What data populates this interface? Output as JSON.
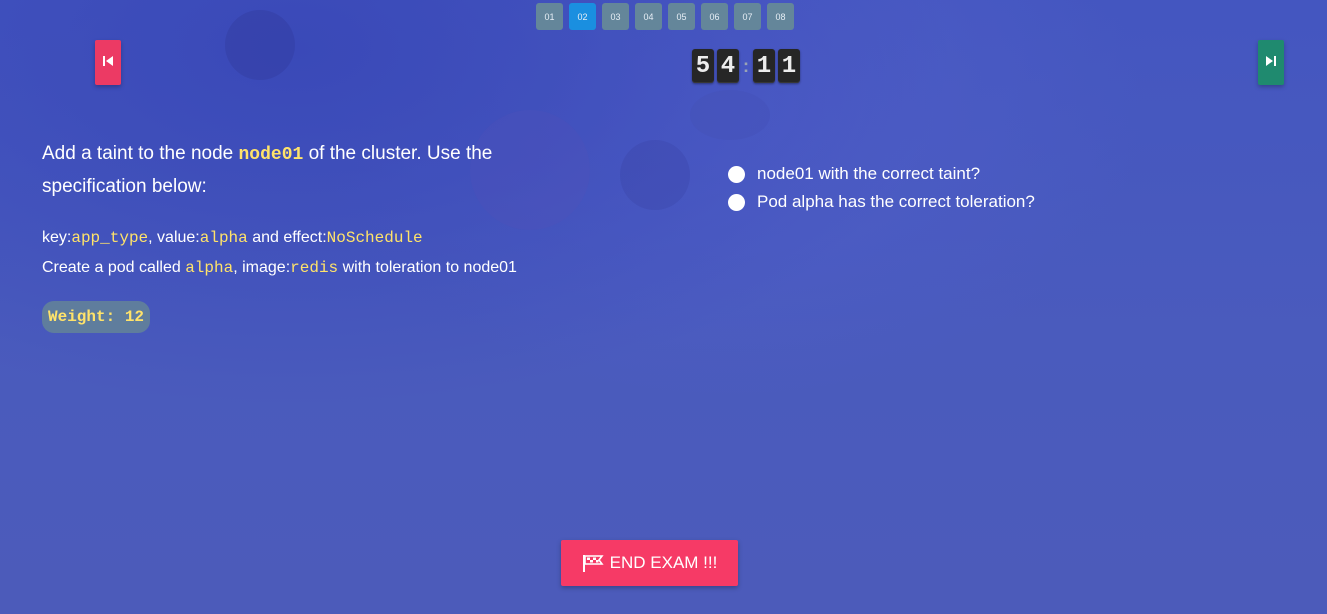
{
  "pager": {
    "items": [
      "01",
      "02",
      "03",
      "04",
      "05",
      "06",
      "07",
      "08"
    ],
    "active": "02"
  },
  "nav": {
    "prev_icon": "skip-back-icon",
    "next_icon": "skip-forward-icon"
  },
  "timer": {
    "minutes": [
      "5",
      "4"
    ],
    "separator": ":",
    "seconds": [
      "1",
      "1"
    ]
  },
  "question": {
    "title_prefix": "Add a taint to the node ",
    "node": "node01",
    "title_suffix": " of the cluster. Use the specification below:",
    "spec_line1": {
      "key_label": "key:",
      "key": "app_type",
      "value_label": ", value:",
      "value": "alpha",
      "effect_label": " and effect:",
      "effect": "NoSchedule"
    },
    "spec_line2": {
      "prefix": "Create a pod called ",
      "pod": "alpha",
      "image_label": ", image:",
      "image": "redis",
      "suffix": " with toleration to node01"
    },
    "weight": "Weight: 12"
  },
  "checklist": [
    "node01 with the correct taint?",
    "Pod alpha has the correct toleration?"
  ],
  "end_button": {
    "label": "END EXAM !!!",
    "icon": "flag-icon"
  },
  "colors": {
    "background": "#4a5bbd",
    "code_highlight": "#ffe36a",
    "prev_button": "#ec3a64",
    "next_button": "#1f8a6f",
    "end_button": "#f63a66",
    "pager_active": "#1a8fe0",
    "pager_inactive": "#64869a"
  }
}
